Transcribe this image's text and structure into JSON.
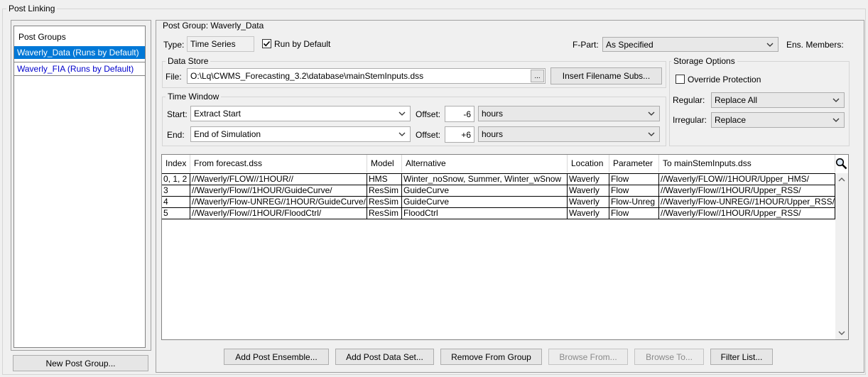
{
  "outer_title": "Post Linking",
  "post_groups": {
    "header": "Post Groups",
    "items": [
      "Waverly_Data (Runs by Default)",
      "Waverly_FIA (Runs by Default)"
    ],
    "selected_index": 0,
    "new_button": "New Post Group..."
  },
  "group": {
    "title": "Post Group: Waverly_Data",
    "type_label": "Type:",
    "type_value": "Time Series",
    "run_default_label": "Run by Default",
    "run_default_checked": true,
    "fpart_label": "F-Part:",
    "fpart_value": "As Specified",
    "ens_label": "Ens. Members:"
  },
  "data_store": {
    "title": "Data Store",
    "file_label": "File:",
    "file_value": "O:\\Lq\\CWMS_Forecasting_3.2\\database\\mainStemInputs.dss",
    "browse_label": "...",
    "insert_button": "Insert Filename Subs..."
  },
  "storage": {
    "title": "Storage Options",
    "override_label": "Override Protection",
    "override_checked": false,
    "regular_label": "Regular:",
    "regular_value": "Replace All",
    "irregular_label": "Irregular:",
    "irregular_value": "Replace"
  },
  "time_window": {
    "title": "Time Window",
    "start_label": "Start:",
    "start_value": "Extract Start",
    "end_label": "End:",
    "end_value": "End of Simulation",
    "offset_label": "Offset:",
    "start_offset": "-6",
    "end_offset": "+6",
    "start_unit": "hours",
    "end_unit": "hours"
  },
  "table": {
    "columns": [
      "Index",
      "From forecast.dss",
      "Model",
      "Alternative",
      "Location",
      "Parameter",
      "To mainStemInputs.dss"
    ],
    "rows": [
      [
        "0, 1, 2",
        "//Waverly/FLOW//1HOUR//",
        "HMS",
        "Winter_noSnow, Summer, Winter_wSnow",
        "Waverly",
        "Flow",
        "//Waverly/FLOW//1HOUR/Upper_HMS/"
      ],
      [
        "3",
        "//Waverly/Flow//1HOUR/GuideCurve/",
        "ResSim",
        "GuideCurve",
        "Waverly",
        "Flow",
        "//Waverly/Flow//1HOUR/Upper_RSS/"
      ],
      [
        "4",
        "//Waverly/Flow-UNREG//1HOUR/GuideCurve/",
        "ResSim",
        "GuideCurve",
        "Waverly",
        "Flow-Unreg",
        "//Waverly/Flow-UNREG//1HOUR/Upper_RSS/"
      ],
      [
        "5",
        "//Waverly/Flow//1HOUR/FloodCtrl/",
        "ResSim",
        "FloodCtrl",
        "Waverly",
        "Flow",
        "//Waverly/Flow//1HOUR/Upper_RSS/"
      ]
    ]
  },
  "buttons": {
    "add_ensemble": "Add Post Ensemble...",
    "add_data_set": "Add Post Data Set...",
    "remove": "Remove From Group",
    "browse_from": "Browse From...",
    "browse_to": "Browse To...",
    "filter": "Filter List..."
  },
  "colors": {
    "selection": "#0078d7",
    "link_text": "#0000cc",
    "window_bg": "#f0f0f0"
  }
}
